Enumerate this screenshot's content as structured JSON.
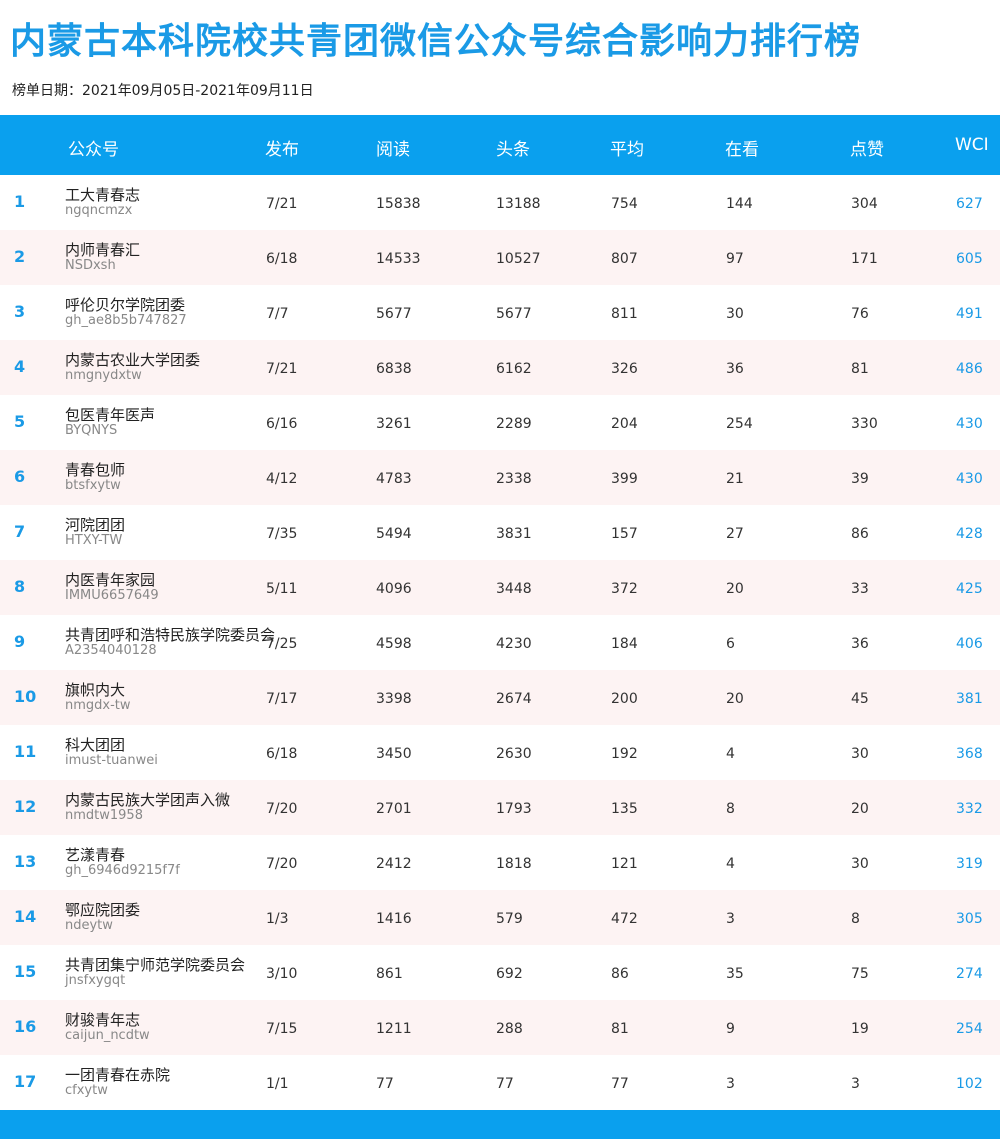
{
  "title": "内蒙古本科院校共青团微信公众号综合影响力排行榜",
  "subtitle": "榜单日期：2021年09月05日-2021年09月11日",
  "colors": {
    "accent": "#0aa0ee",
    "title": "#1a9ae6",
    "alt_row": "#fdf3f3"
  },
  "columns": {
    "account": "公众号",
    "publish": "发布",
    "read": "阅读",
    "headline": "头条",
    "average": "平均",
    "watching": "在看",
    "like": "点赞",
    "wci": "WCI"
  },
  "rows": [
    {
      "rank": "1",
      "name": "工大青春志",
      "id": "ngqncmzx",
      "publish": "7/21",
      "read": "15838",
      "headline": "13188",
      "average": "754",
      "watching": "144",
      "like": "304",
      "wci": "627"
    },
    {
      "rank": "2",
      "name": "内师青春汇",
      "id": "NSDxsh",
      "publish": "6/18",
      "read": "14533",
      "headline": "10527",
      "average": "807",
      "watching": "97",
      "like": "171",
      "wci": "605"
    },
    {
      "rank": "3",
      "name": "呼伦贝尔学院团委",
      "id": "gh_ae8b5b747827",
      "publish": "7/7",
      "read": "5677",
      "headline": "5677",
      "average": "811",
      "watching": "30",
      "like": "76",
      "wci": "491"
    },
    {
      "rank": "4",
      "name": "内蒙古农业大学团委",
      "id": "nmgnydxtw",
      "publish": "7/21",
      "read": "6838",
      "headline": "6162",
      "average": "326",
      "watching": "36",
      "like": "81",
      "wci": "486"
    },
    {
      "rank": "5",
      "name": "包医青年医声",
      "id": "BYQNYS",
      "publish": "6/16",
      "read": "3261",
      "headline": "2289",
      "average": "204",
      "watching": "254",
      "like": "330",
      "wci": "430"
    },
    {
      "rank": "6",
      "name": "青春包师",
      "id": "btsfxytw",
      "publish": "4/12",
      "read": "4783",
      "headline": "2338",
      "average": "399",
      "watching": "21",
      "like": "39",
      "wci": "430"
    },
    {
      "rank": "7",
      "name": "河院团团",
      "id": "HTXY-TW",
      "publish": "7/35",
      "read": "5494",
      "headline": "3831",
      "average": "157",
      "watching": "27",
      "like": "86",
      "wci": "428"
    },
    {
      "rank": "8",
      "name": "内医青年家园",
      "id": "IMMU6657649",
      "publish": "5/11",
      "read": "4096",
      "headline": "3448",
      "average": "372",
      "watching": "20",
      "like": "33",
      "wci": "425"
    },
    {
      "rank": "9",
      "name": "共青团呼和浩特民族学院委员会",
      "id": "A2354040128",
      "publish": "7/25",
      "read": "4598",
      "headline": "4230",
      "average": "184",
      "watching": "6",
      "like": "36",
      "wci": "406"
    },
    {
      "rank": "10",
      "name": "旗帜内大",
      "id": "nmgdx-tw",
      "publish": "7/17",
      "read": "3398",
      "headline": "2674",
      "average": "200",
      "watching": "20",
      "like": "45",
      "wci": "381"
    },
    {
      "rank": "11",
      "name": "科大团团",
      "id": "imust-tuanwei",
      "publish": "6/18",
      "read": "3450",
      "headline": "2630",
      "average": "192",
      "watching": "4",
      "like": "30",
      "wci": "368"
    },
    {
      "rank": "12",
      "name": "内蒙古民族大学团声入微",
      "id": "nmdtw1958",
      "publish": "7/20",
      "read": "2701",
      "headline": "1793",
      "average": "135",
      "watching": "8",
      "like": "20",
      "wci": "332"
    },
    {
      "rank": "13",
      "name": "艺漾青春",
      "id": "gh_6946d9215f7f",
      "publish": "7/20",
      "read": "2412",
      "headline": "1818",
      "average": "121",
      "watching": "4",
      "like": "30",
      "wci": "319"
    },
    {
      "rank": "14",
      "name": "鄂应院团委",
      "id": "ndeytw",
      "publish": "1/3",
      "read": "1416",
      "headline": "579",
      "average": "472",
      "watching": "3",
      "like": "8",
      "wci": "305"
    },
    {
      "rank": "15",
      "name": "共青团集宁师范学院委员会",
      "id": "jnsfxygqt",
      "publish": "3/10",
      "read": "861",
      "headline": "692",
      "average": "86",
      "watching": "35",
      "like": "75",
      "wci": "274"
    },
    {
      "rank": "16",
      "name": "财骏青年志",
      "id": "caijun_ncdtw",
      "publish": "7/15",
      "read": "1211",
      "headline": "288",
      "average": "81",
      "watching": "9",
      "like": "19",
      "wci": "254"
    },
    {
      "rank": "17",
      "name": "一团青春在赤院",
      "id": "cfxytw",
      "publish": "1/1",
      "read": "77",
      "headline": "77",
      "average": "77",
      "watching": "3",
      "like": "3",
      "wci": "102"
    }
  ]
}
